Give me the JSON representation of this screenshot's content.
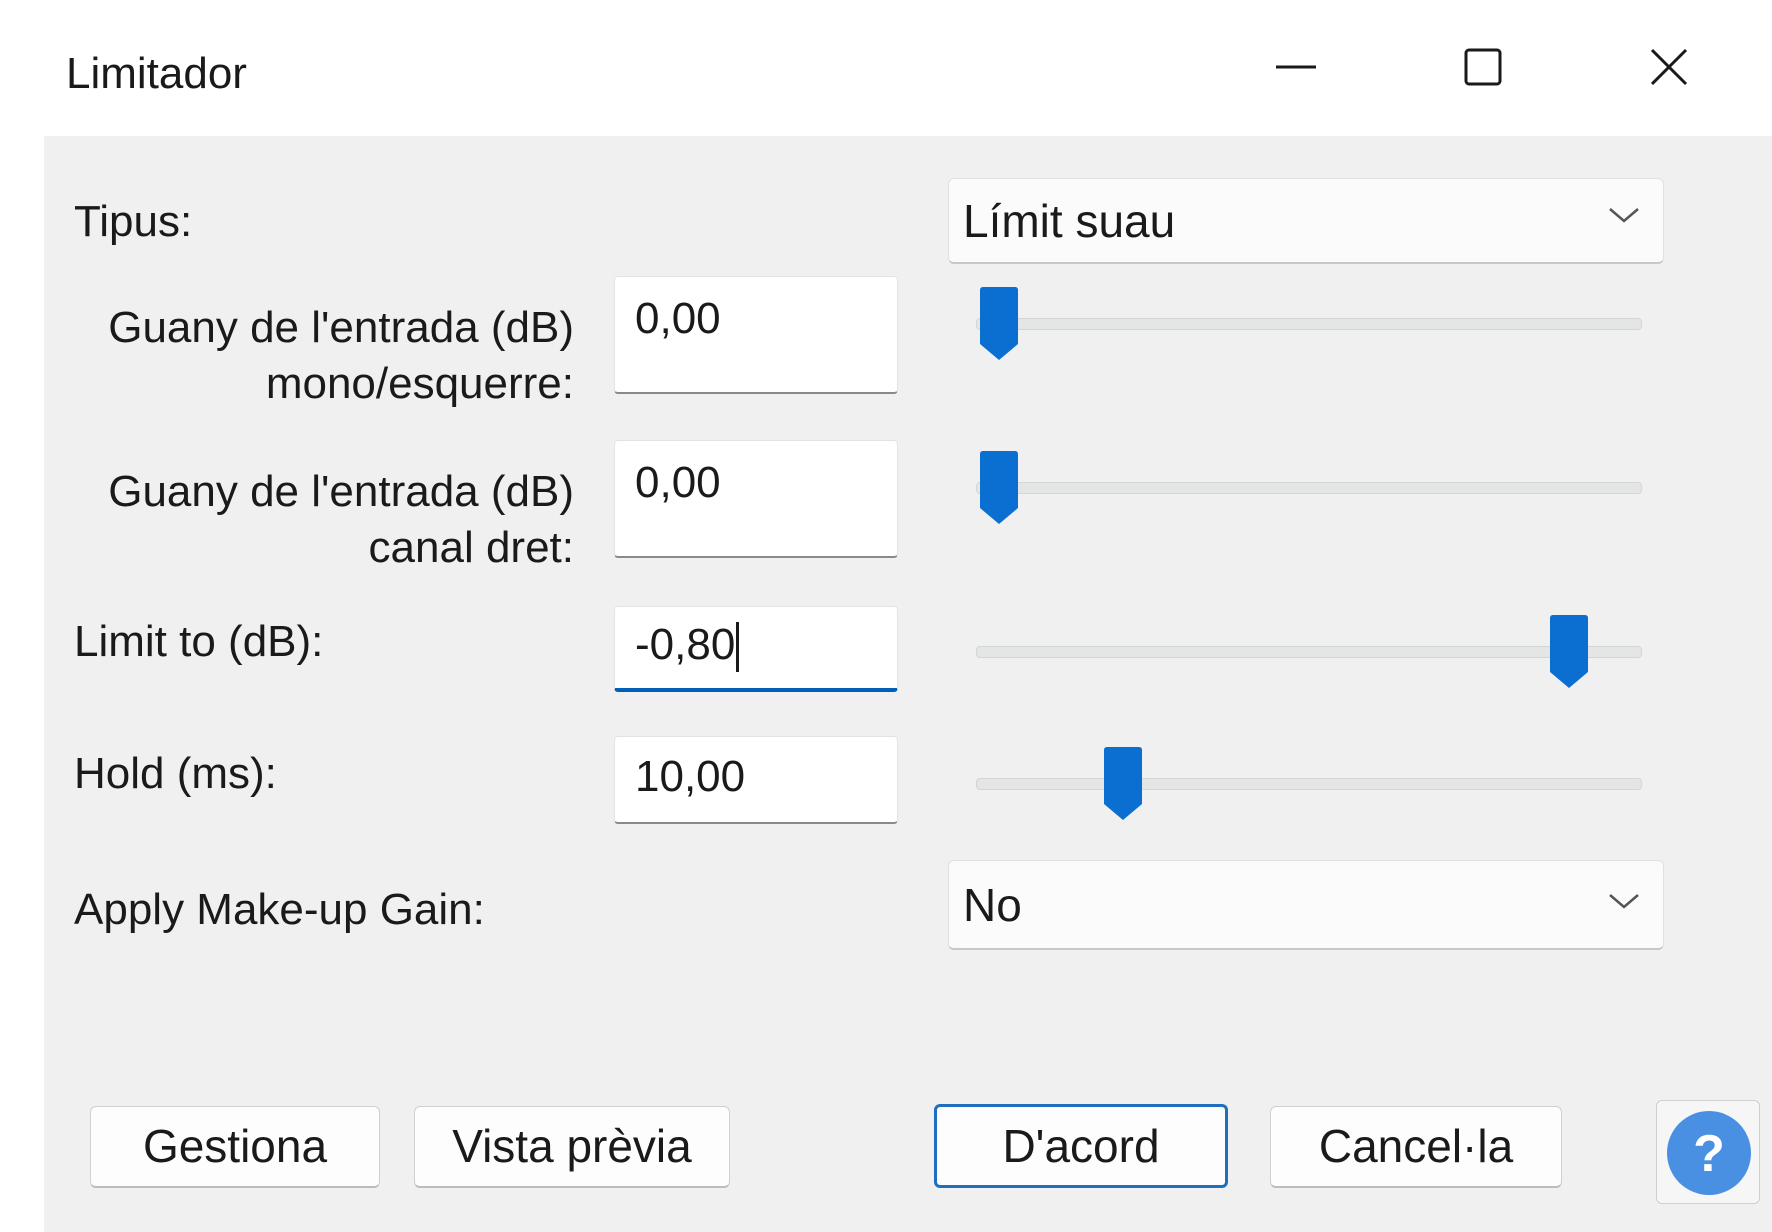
{
  "window": {
    "title": "Limitador"
  },
  "form": {
    "type": {
      "label": "Tipus:",
      "value": "Límit suau"
    },
    "gain_left": {
      "label_line1": "Guany de l'entrada (dB)",
      "label_line2": "mono/esquerre:",
      "value": "0,00",
      "slider_fraction": 0.0
    },
    "gain_right": {
      "label_line1": "Guany de l'entrada (dB)",
      "label_line2": "canal dret:",
      "value": "0,00",
      "slider_fraction": 0.0
    },
    "limit_to": {
      "label": "Limit to (dB):",
      "value": "-0,80",
      "slider_fraction": 0.92
    },
    "hold": {
      "label": "Hold (ms):",
      "value": "10,00",
      "slider_fraction": 0.2
    },
    "makeup": {
      "label": "Apply Make-up Gain:",
      "value": "No"
    }
  },
  "buttons": {
    "manage": "Gestiona",
    "preview": "Vista prèvia",
    "ok": "D'acord",
    "cancel": "Cancel·la",
    "help_glyph": "?"
  },
  "colors": {
    "accent": "#0a6fd1",
    "help": "#4a90e2"
  }
}
